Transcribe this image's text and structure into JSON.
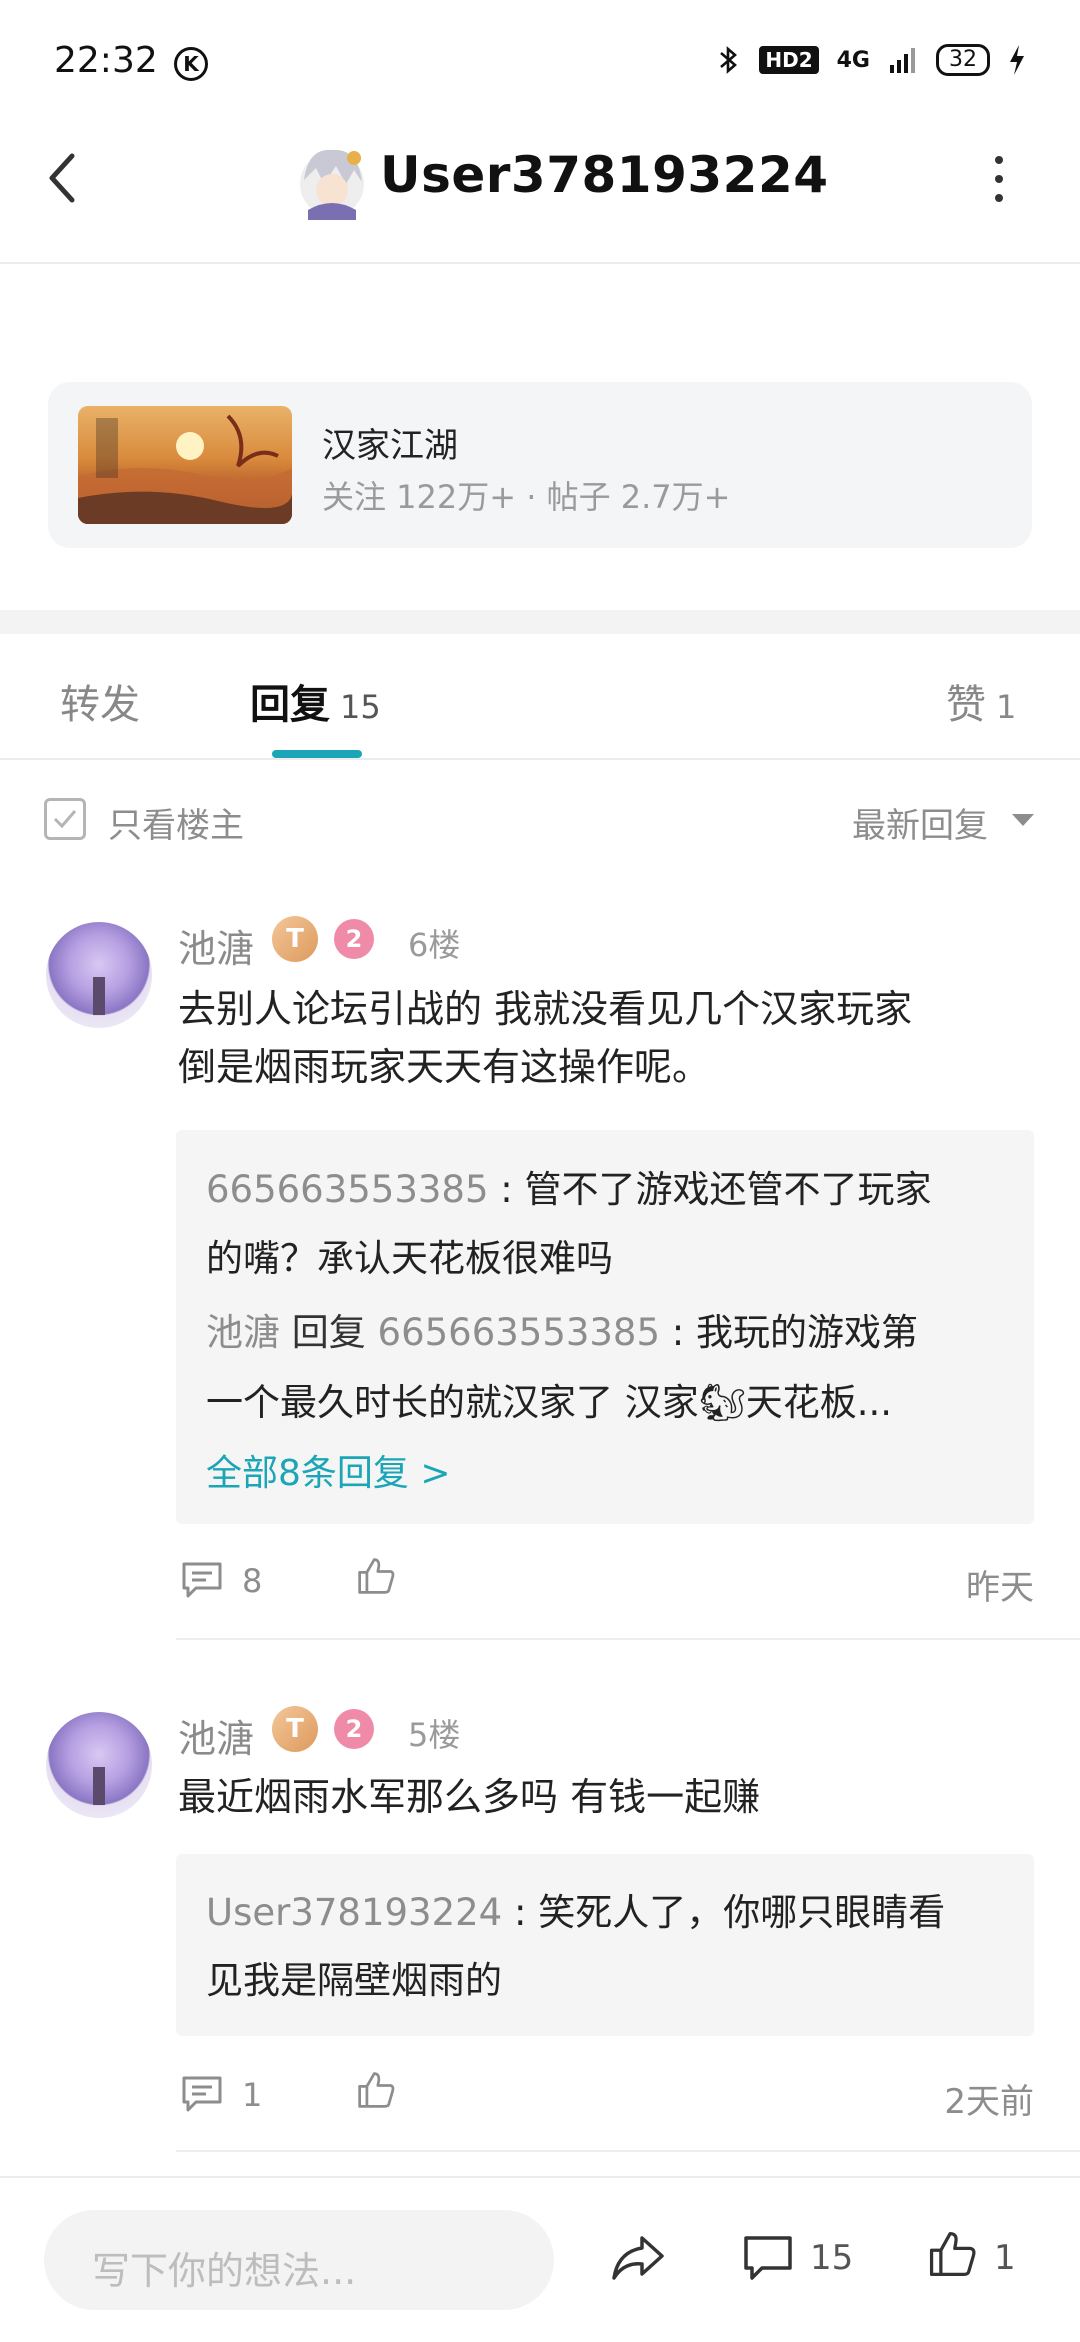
{
  "status_bar": {
    "time": "22:32",
    "network": "4G",
    "hd": "HD2",
    "battery": "32",
    "icons": [
      "k-app-icon",
      "bluetooth-icon",
      "signal-icon",
      "battery-icon",
      "charging-icon"
    ]
  },
  "header": {
    "title": "User378193224",
    "back_icon": "chevron-left-icon",
    "more_icon": "more-vertical-icon"
  },
  "forum": {
    "name": "汉家江湖",
    "stats": "关注 122万+ · 帖子 2.7万+"
  },
  "tabs": {
    "repost": "转发",
    "reply": "回复",
    "reply_count": "15",
    "like": "赞",
    "like_count": "1"
  },
  "filter": {
    "only_op": "只看楼主",
    "sort": "最新回复"
  },
  "comments": [
    {
      "user": "池溏",
      "level_badge": "T",
      "num_badge": "2",
      "floor": "6楼",
      "text_line1": "去别人论坛引战的 我就没看见几个汉家玩家",
      "text_line2": "倒是烟雨玩家天天有这操作呢。",
      "replies": [
        {
          "user": "665663553385",
          "sep": ":",
          "line1": "管不了游戏还管不了玩家",
          "line2": "的嘴？承认天花板很难吗"
        },
        {
          "user": "池溏",
          "reply_word": "回复",
          "target": "665663553385",
          "sep": ":",
          "line1": "我玩的游戏第",
          "line2": "一个最久时长的就汉家了 汉家🐿天花板..."
        }
      ],
      "all_replies": "全部8条回复 >",
      "comment_count": "8",
      "time": "昨天"
    },
    {
      "user": "池溏",
      "level_badge": "T",
      "num_badge": "2",
      "floor": "5楼",
      "text_line1": "最近烟雨水军那么多吗 有钱一起赚",
      "replies": [
        {
          "user": "User378193224",
          "sep": ":",
          "line1": "笑死人了，你哪只眼睛看",
          "line2": "见我是隔壁烟雨的"
        }
      ],
      "comment_count": "1",
      "time": "2天前"
    }
  ],
  "bottom_bar": {
    "input_placeholder": "写下你的想法...",
    "comment_count": "15",
    "like_count": "1"
  },
  "colors": {
    "accent": "#1aa6b7",
    "muted_text": "#8d8d8d",
    "card_bg": "#f4f5f7",
    "reply_bg": "#f5f5f5"
  }
}
